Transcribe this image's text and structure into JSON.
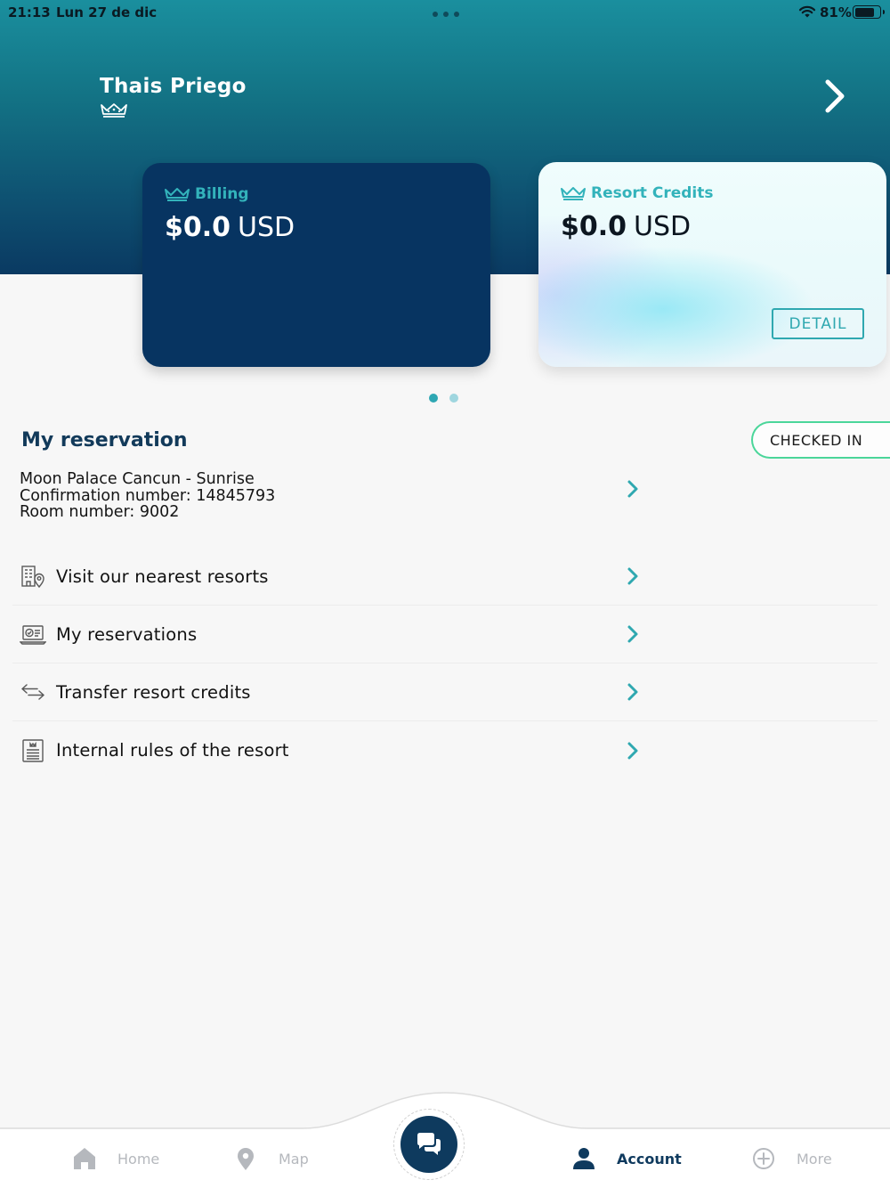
{
  "status_bar": {
    "time": "21:13",
    "date": "Lun 27 de dic",
    "battery": "81%"
  },
  "profile": {
    "name": "Thais Priego"
  },
  "cards": {
    "billing": {
      "title": "Billing",
      "amount": "$0.0",
      "currency": "USD"
    },
    "credits": {
      "title": "Resort Credits",
      "amount": "$0.0",
      "currency": "USD",
      "detail_label": "DETAIL"
    }
  },
  "pager": {
    "pages": 2,
    "current": 1
  },
  "reservation": {
    "section_title": "My reservation",
    "status": "CHECKED IN",
    "hotel": "Moon Palace Cancun - Sunrise",
    "confirmation": "Confirmation number: 14845793",
    "room": "Room number: 9002"
  },
  "menu": [
    {
      "label": "Visit our nearest resorts",
      "icon": "hotel-location-icon"
    },
    {
      "label": "My reservations",
      "icon": "reservation-laptop-icon"
    },
    {
      "label": "Transfer resort credits",
      "icon": "transfer-arrows-icon"
    },
    {
      "label": "Internal rules of the resort",
      "icon": "rules-document-icon"
    }
  ],
  "tabs": {
    "home": "Home",
    "map": "Map",
    "account": "Account",
    "more": "More"
  },
  "colors": {
    "accent": "#2fa8b0",
    "navy": "#073461",
    "status_green": "#4bd69a"
  }
}
